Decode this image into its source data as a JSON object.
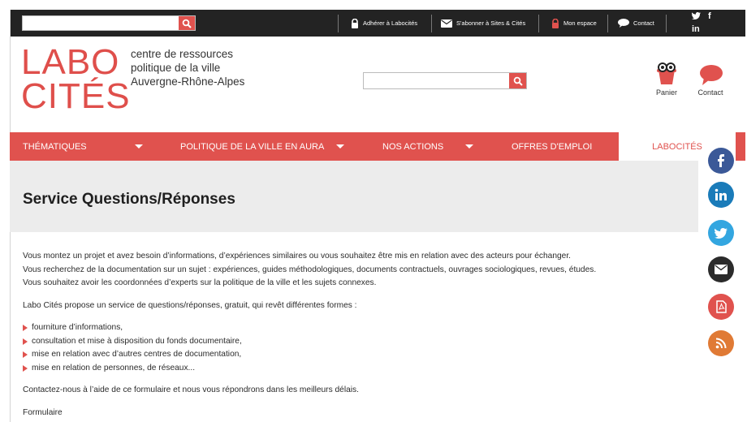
{
  "topbar": {
    "search_placeholder": "",
    "links": {
      "adherer": "Adhérer à Labocités",
      "abonner": "S'abonner à Sites & Cités",
      "espace": "Mon espace",
      "contact": "Contact"
    },
    "social": {
      "twitter": "🐦",
      "facebook": "f",
      "linkedin": "in"
    }
  },
  "header": {
    "logo_line1": "LABO",
    "logo_line2": "CITÉS",
    "tagline": [
      "centre de ressources",
      "politique de la ville",
      "Auvergne-Rhône-Alpes"
    ],
    "search_placeholder": "",
    "panier_label": "Panier",
    "contact_label": "Contact"
  },
  "nav": {
    "items": [
      {
        "label": "THÉMATIQUES"
      },
      {
        "label": "POLITIQUE DE LA VILLE EN AURA"
      },
      {
        "label": "NOS ACTIONS"
      },
      {
        "label": "OFFRES D'EMPLOI"
      }
    ],
    "active": "LABOCITÉS"
  },
  "page": {
    "title": "Service Questions/Réponses",
    "intro": [
      "Vous montez un projet et avez besoin d’informations, d’expériences similaires ou vous souhaitez être mis en relation avec des acteurs pour échanger.",
      "Vous recherchez de la documentation sur un sujet : expériences, guides méthodologiques, documents contractuels, ouvrages sociologiques, revues, études.",
      "Vous souhaitez avoir les coordonnées d’experts sur la politique de la ville et les sujets connexes."
    ],
    "service_intro": "Labo Cités propose un service de questions/réponses, gratuit, qui revêt différentes formes :",
    "bullets": [
      "fourniture d’informations,",
      "consultation et mise à disposition du fonds documentaire,",
      "mise en relation avec d’autres centres de documentation,",
      "mise en relation de personnes, de réseaux..."
    ],
    "contact_text": "Contactez-nous à l’aide de ce formulaire et nous vous répondrons dans les meilleurs délais.",
    "form_label": "Formulaire"
  },
  "share_colors": {
    "facebook": "#3b5998",
    "linkedin": "#1a7bb9",
    "twitter": "#33a6e0",
    "email": "#2b2b2b",
    "pdf": "#e0524e",
    "rss": "#e07a35"
  },
  "colors": {
    "accent": "#e0524e",
    "topbar": "#232323"
  }
}
